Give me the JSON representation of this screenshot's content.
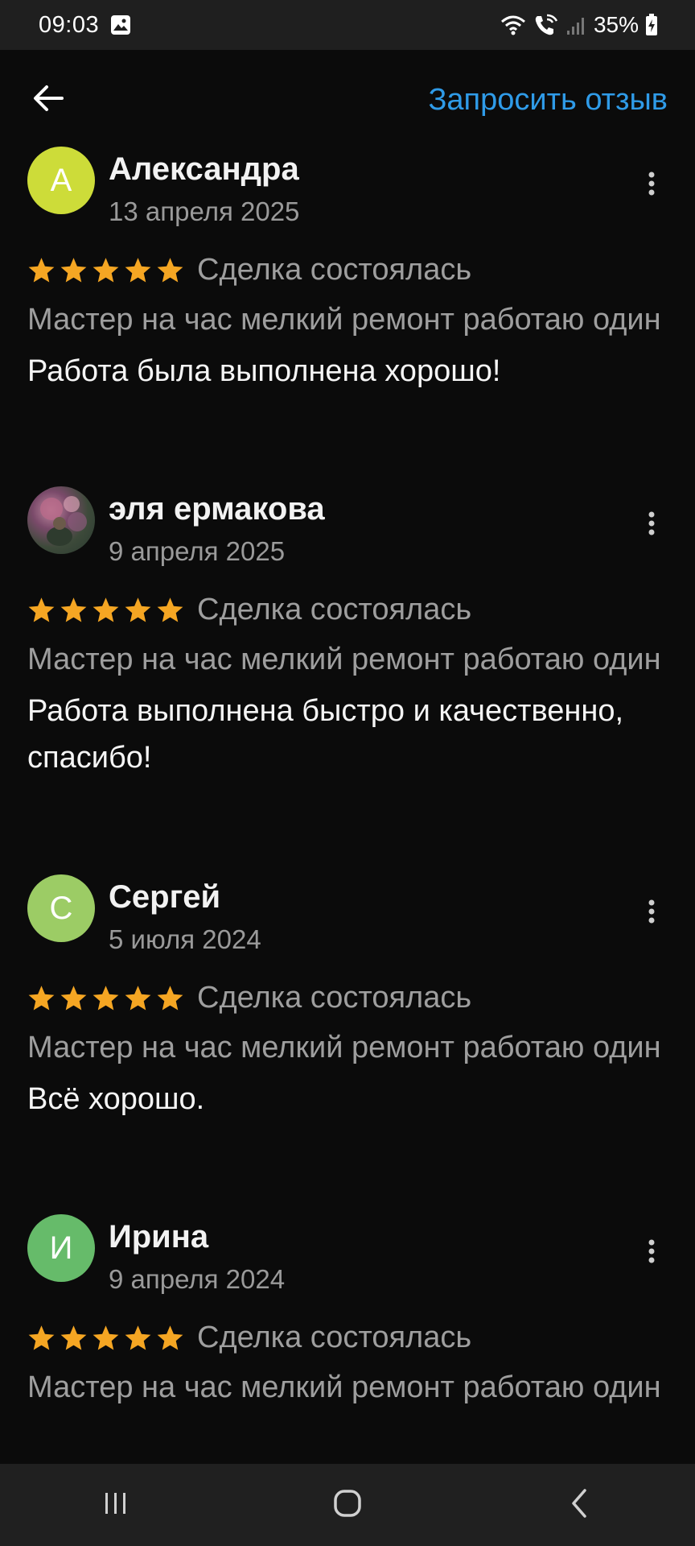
{
  "status_bar": {
    "time": "09:03",
    "battery_text": "35%"
  },
  "top_bar": {
    "request_review_label": "Запросить отзыв"
  },
  "colors": {
    "accent": "#2f9be8",
    "star": "#f5a623",
    "background": "#0b0b0b"
  },
  "reviews": [
    {
      "avatar_letter": "А",
      "avatar_color": "#cddc39",
      "author": "Александра",
      "date": "13 апреля 2025",
      "rating": 5,
      "deal_status": "Сделка состоялась",
      "service": "Мастер на час мелкий ремонт работаю один",
      "text": "Работа была выполнена хорошо!"
    },
    {
      "avatar_letter": "",
      "avatar_color": "",
      "author": "эля ермакова",
      "date": "9 апреля 2025",
      "rating": 5,
      "deal_status": "Сделка состоялась",
      "service": "Мастер на час мелкий ремонт работаю один",
      "text": "Работа выполнена быстро и качественно, спасибо!"
    },
    {
      "avatar_letter": "С",
      "avatar_color": "#9ccc65",
      "author": "Сергей",
      "date": "5 июля 2024",
      "rating": 5,
      "deal_status": "Сделка состоялась",
      "service": "Мастер на час мелкий ремонт работаю один",
      "text": "Всё хорошо."
    },
    {
      "avatar_letter": "И",
      "avatar_color": "#66bb6a",
      "author": "Ирина",
      "date": "9 апреля 2024",
      "rating": 5,
      "deal_status": "Сделка состоялась",
      "service": "Мастер на час мелкий ремонт работаю один",
      "text": ""
    }
  ],
  "icons": {
    "back": "arrow-left-icon",
    "more": "more-vertical-icon",
    "star": "star-icon",
    "nav_recent": "recent-apps-icon",
    "nav_home": "home-icon",
    "nav_back": "back-chevron-icon"
  }
}
